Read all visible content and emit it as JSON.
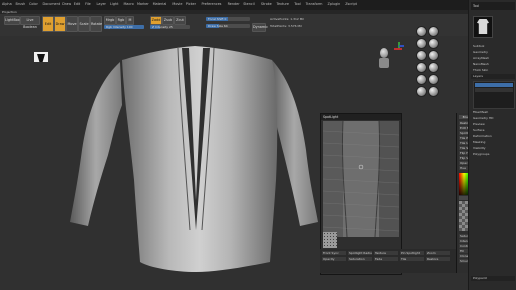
{
  "menubar": {
    "items": [
      "Alpha",
      "Brush",
      "Color",
      "Document",
      "Draw",
      "Edit",
      "File",
      "Layer",
      "Light",
      "Macro",
      "Marker",
      "Material",
      "Movie",
      "Picker",
      "Preferences",
      "Render",
      "Stencil",
      "Stroke",
      "Texture",
      "Tool",
      "Transform",
      "Zplugin",
      "Zscript"
    ],
    "right_items": [
      "QuickSave",
      "See-through 0",
      "Menus",
      "DefaultZScript"
    ]
  },
  "status": {
    "text": "Projection"
  },
  "toolbar": {
    "lightbox_label": "LightBox",
    "live_boolean_label": "Live Boolean",
    "edit_label": "Edit",
    "draw_label": "Draw",
    "move_label": "Move",
    "scale_label": "Scale",
    "rotate_label": "Rotate",
    "mrgb_label": "Mrgb",
    "rgb_label": "Rgb",
    "m_label": "M",
    "zadd_label": "Zadd",
    "zsub_label": "Zsub",
    "zcut_label": "Zcut",
    "rgb_intensity": "Rgb Intensity 100",
    "z_intensity": "Z Intensity 25",
    "focal_shift": "Focal Shift 0",
    "draw_size": "Draw Size 64",
    "dynamic_label": "Dynamic",
    "active_points": "ActivePoints: 1.312 Mil",
    "total_points": "TotalPoints: 3.576 Mil",
    "persp_label": "Persp",
    "floor_label": "Floor"
  },
  "rightdock": {
    "header": "Tool",
    "thumb_label": "Shirt",
    "items": [
      "Subtool",
      "Geometry",
      "ArrayMesh",
      "NanoMesh",
      "Thick Skin",
      "Layers",
      "FiberMesh",
      "Geometry HD",
      "Preview",
      "Surface",
      "Deformation",
      "Masking",
      "Visibility",
      "Polygroups"
    ],
    "bottom": "Polypaint"
  },
  "texwin": {
    "title": "SpotLight"
  },
  "texpanel": {
    "rows": [
      "Restore",
      "Edit Spotlight",
      "Spotlight Radius 64",
      "Tile Proportional",
      "Tile Unified",
      "Tile Selected",
      "Flip H",
      "Flip V",
      "Opacity 100",
      "Hue",
      "Saturation",
      "Intensity",
      "Contrast",
      "Fill",
      "Clone",
      "Smudge"
    ],
    "buttons": [
      "Brush",
      "Color",
      "Grey"
    ],
    "fill_label": "Fill",
    "paint_label": "Paint"
  },
  "texbottom": {
    "rows": [
      "Front Sync",
      "Spotlight Radius",
      "Texture",
      "Pin Spotlight",
      "Zoom",
      "Opacity",
      "Saturation",
      "Fade",
      "Tile",
      "Restore"
    ]
  }
}
